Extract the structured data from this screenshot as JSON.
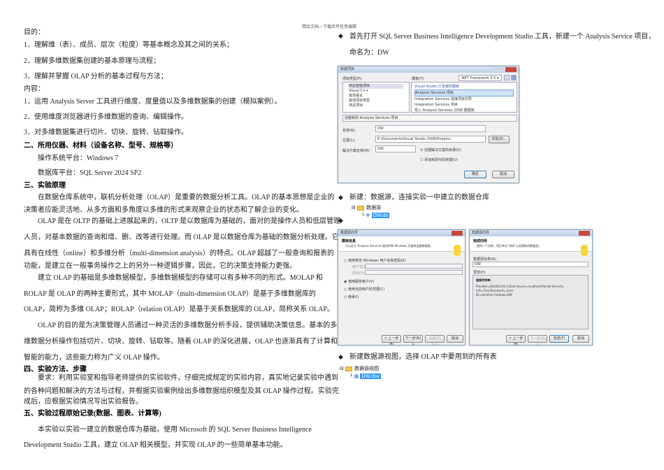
{
  "header": "精品文档---下载后可任意编辑",
  "left": {
    "lines": [
      {
        "text": "目的："
      },
      {
        "text": "1．理解维（表）、成员、层次（粒度）等基本概念及其之间的关系；"
      },
      {
        "text": "2．理解多维数据集创建的基本原理与流程；"
      },
      {
        "text": "3．理解并掌握 OLAP 分析的基本过程与方法；"
      },
      {
        "text": "内容："
      },
      {
        "text": "1．运用 Analysis Server 工具进行维度、度量值以及多维数据集的创建（模拟案例）。"
      },
      {
        "text": "2．使用维度浏览器进行多维数据的查询、编辑操作。"
      },
      {
        "text": "3．对多维数据集进行切片、切块、旋转、钻取操作。"
      },
      {
        "text": "二、所用仪器、材料（设备名称、型号、规格等）",
        "bold": true
      },
      {
        "text": "操作系统平台：Windows 7",
        "indent": true
      },
      {
        "text": "数据库平台：SQL Server 2024 SP2",
        "indent": true
      },
      {
        "text": "三、实验原理",
        "bold": true
      },
      {
        "text": "在数据仓库系统中，联机分析处理（OLAP）是重要的数据分析工具。OLAP 的基本思想是企业的",
        "indent": true
      },
      {
        "text": "决策者应能灵活地、从多方面和多角度以多维的形式来观察企业的状态和了解企业的变化。"
      },
      {
        "text": "OLAP 是在 OLTP 的基础上进展起来的，OLTP 是以数据库为基础的，面对的是操作人员和低层管理",
        "indent": true
      },
      {
        "text": "人员，对基本数据的查询和增、删、改等进行处理。而 OLAP 是以数据仓库为基础的数据分析处理。它"
      },
      {
        "text": "具有在线性（online）和多维分析（multi-dimension analysis）的特点。OLAP 超越了一般查询和报表的"
      },
      {
        "text": "功能，是建立在一般事务操作之上的另外一种逻辑步骤，因此，它的决策支持能力更强。"
      },
      {
        "text": "建立 OLAP 的基础是多维数据模型，多维数据模型的存储可以有多种不同的形式。MOLAP 和",
        "indent": true
      },
      {
        "text": "ROLAP 是 OLAP 的两种主要形式，其中 MOLAP（multi-dimension OLAP）是基于多维数据库的"
      },
      {
        "text": "OLAP，简称为多维 OLAP；ROLAP（relation OLAP）是基于关系数据库的 OLAP，简称关系 OLAP。"
      },
      {
        "text": "OLAP 的目的是为决策管理人员通过一种灵活的多维数据分析手段，提供辅助决策信息。基本的多",
        "indent": true
      },
      {
        "text": "维数据分析操作包括切片、切块、旋转、钻取等。随着 OLAP 的深化进展，OLAP 也逐渐具有了计算和"
      },
      {
        "text": "智能的能力，这些能力称为广义 OLAP 操作。"
      },
      {
        "text": "四、实验方法、步骤",
        "bold": true
      },
      {
        "text": "要求：利用实验室和指导老师提供的实验软件，仔细完成规定的实验内容，真实地记录实验中遇到",
        "indent": true
      },
      {
        "text": "的各种问题和解决的方法与过程，并根据实验案例绘出多维数据组织模型及其 OLAP 操作过程。实验完"
      },
      {
        "text": "成后，应根据实验情况写出实验报告。"
      },
      {
        "text": "五、实验过程原始记录(数据、图表、计算等)",
        "bold": true
      },
      {
        "text": "本实验以实验一建立的数据仓库为基础，使用 Microsoft 的 SQL Server Business Intelligence",
        "indent": true
      },
      {
        "text": "Development Studio 工具，建立 OLAP 相关模型，并实现 OLAP 的一些简单基本功能。"
      }
    ]
  },
  "right": {
    "bullet_icon": "diamond-bullet-icon",
    "step1": [
      "首先打开 SQL Server Business Intelligence Development Studio 工具，新建一个 Analysis Service 项目，",
      "命名为：DW"
    ],
    "dialog": {
      "title": "新建项目",
      "project_types_label": "项目类型(P):",
      "templates_label": "模板(T):",
      "framework": ".NET Framework 3.5",
      "types": [
        "商业智能项目",
        "Visual C++",
        "其他语言",
        "其他项目类型",
        "测试项目"
      ],
      "templates_header": "Visual Studio 已安装的模板",
      "templates": [
        "Analysis Services 项目",
        "Integration Services 连接项目向导",
        "Integration Services 项目",
        "导入 Analysis Services 2008 数据库"
      ],
      "description": "创建新的 Analysis Services 项目",
      "name_label": "名称(N):",
      "name_value": "DW",
      "location_label": "位置(L):",
      "location_value": "E:\\Documents\\Visual Studio 2008\\Projects",
      "browse": "浏览(B)...",
      "solution_label": "解决方案名称(M):",
      "solution_value": "DW",
      "create_dir": "创建解决方案的目录(D)",
      "add_source": "添加到源代码管理(U)",
      "ok": "确定",
      "cancel": "取消"
    },
    "step2": "新建：数据源，连接实验一中建立的数据仓库",
    "tree1": {
      "folder": "数据源",
      "item": "DW.ds"
    },
    "wizard1": {
      "title": "数据源向导",
      "heading": "模拟信息",
      "sub": "可以定义 Analysis Services 使用何种 Windows 凭据来连接数据源。",
      "options": [
        "使用特定 Windows 用户名和密码(S)",
        "使用服务帐户(V)",
        "使用当前用户的凭据(C)",
        "继承(I)"
      ],
      "user_label": "用户名(U):",
      "pwd_label": "密码(P):",
      "buttons": [
        "< 上一步(B)",
        "下一步(N) >",
        "完成(F) >>|",
        "取消"
      ]
    },
    "wizard2": {
      "title": "数据源向导",
      "heading": "完成向导",
      "sub": "提供一个名称，然后单击“完成”以创建新的数据源。",
      "name_label": "数据源名称(A):",
      "name_value": "DW",
      "preview_label": "预览(P):",
      "conn_label": "连接字符串:",
      "conn": "Provider=SQLNCLI10.1;Data Source=localhost;Persist Security Info=True;Password=;User",
      "conn2": "ID=sa;Initial Catalog=DW",
      "buttons": [
        "< 上一步(B)",
        "下一步(N) >",
        "完成(F)",
        "取消"
      ]
    },
    "step3": "新建数据源视图，选择 OLAP 中要用到的所有表",
    "tree2": {
      "folder": "数据源视图",
      "item": "DW.dsv"
    }
  }
}
